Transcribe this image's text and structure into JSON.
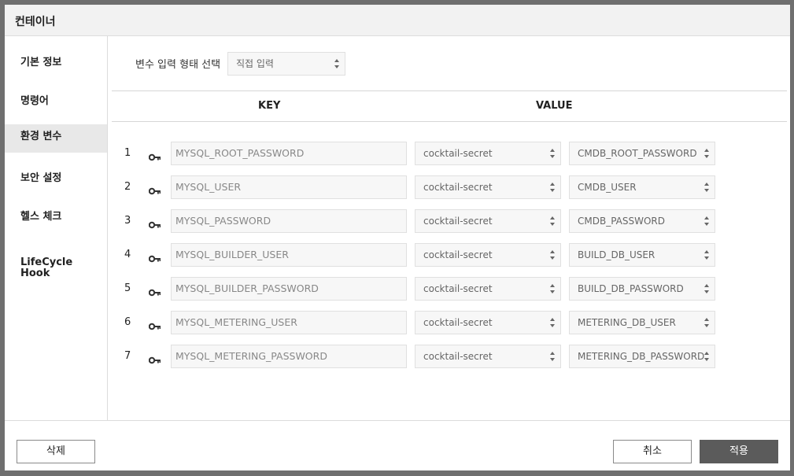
{
  "dialog": {
    "title": "컨테이너"
  },
  "sidebar": {
    "items": [
      {
        "label": "기본 정보"
      },
      {
        "label": "명령어"
      },
      {
        "label": "환경 변수"
      },
      {
        "label": "보안 설정"
      },
      {
        "label": "헬스 체크"
      },
      {
        "label": "LifeCycle\nHook"
      }
    ]
  },
  "main": {
    "input_type_label": "변수 입력 형태 선택",
    "input_type_value": "직접 입력",
    "columns": {
      "key": "KEY",
      "value": "VALUE"
    },
    "rows": [
      {
        "num": "1",
        "key": "MYSQL_ROOT_PASSWORD",
        "secret": "cocktail-secret",
        "secret_key": "CMDB_ROOT_PASSWORD"
      },
      {
        "num": "2",
        "key": "MYSQL_USER",
        "secret": "cocktail-secret",
        "secret_key": "CMDB_USER"
      },
      {
        "num": "3",
        "key": "MYSQL_PASSWORD",
        "secret": "cocktail-secret",
        "secret_key": "CMDB_PASSWORD"
      },
      {
        "num": "4",
        "key": "MYSQL_BUILDER_USER",
        "secret": "cocktail-secret",
        "secret_key": "BUILD_DB_USER"
      },
      {
        "num": "5",
        "key": "MYSQL_BUILDER_PASSWORD",
        "secret": "cocktail-secret",
        "secret_key": "BUILD_DB_PASSWORD"
      },
      {
        "num": "6",
        "key": "MYSQL_METERING_USER",
        "secret": "cocktail-secret",
        "secret_key": "METERING_DB_USER"
      },
      {
        "num": "7",
        "key": "MYSQL_METERING_PASSWORD",
        "secret": "cocktail-secret",
        "secret_key": "METERING_DB_PASSWORD"
      }
    ]
  },
  "footer": {
    "delete_label": "삭제",
    "cancel_label": "취소",
    "apply_label": "적용"
  },
  "colors": {
    "overlay": "#6f6f6f",
    "apply_button": "#5b5b5b",
    "active_sidebar": "#e8e8e8"
  }
}
